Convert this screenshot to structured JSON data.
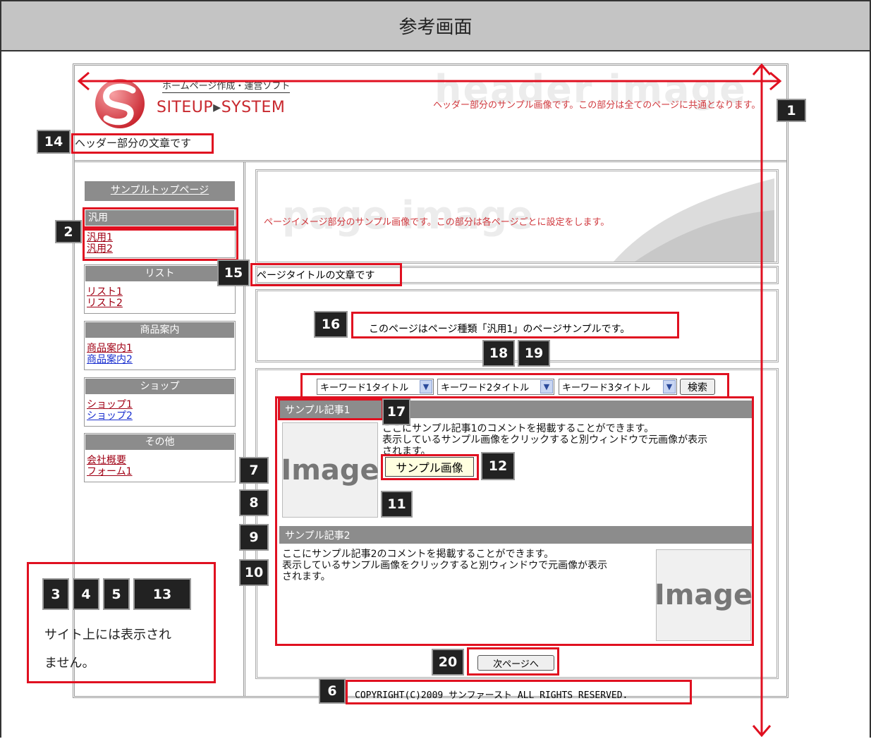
{
  "title": "参考画面",
  "header": {
    "logo_top": "ホームページ作成・運営ソフト",
    "logo_main_a": "SITEUP",
    "logo_main_b": "SYSTEM",
    "watermark": "header image",
    "sample_text": "ヘッダー部分のサンプル画像です。この部分は全てのページに共通となります。",
    "text": "ヘッダー部分の文章です"
  },
  "sidebar": {
    "top_link": "サンプルトップページ",
    "groups": [
      {
        "head": "汎用",
        "links": [
          "汎用1",
          "汎用2"
        ]
      },
      {
        "head": "リスト",
        "links": [
          "リスト1",
          "リスト2"
        ]
      },
      {
        "head": "商品案内",
        "links": [
          "商品案内1",
          "商品案内2"
        ]
      },
      {
        "head": "ショップ",
        "links": [
          "ショップ1",
          "ショップ2"
        ]
      },
      {
        "head": "その他",
        "links": [
          "会社概要",
          "フォーム1"
        ]
      }
    ]
  },
  "page_image": {
    "watermark": "page image",
    "sample_text": "ページイメージ部分のサンプル画像です。この部分は各ページごとに設定をします。"
  },
  "page_title": "ページタイトルの文章です",
  "intro": "このページはページ種類「汎用1」のページサンプルです。",
  "search": {
    "keyword1": "キーワード1タイトル",
    "keyword2": "キーワード2タイトル",
    "keyword3": "キーワード3タイトル",
    "button": "検索"
  },
  "articles": [
    {
      "title": "サンプル記事1",
      "line1": "ここにサンプル記事1のコメントを掲載することができます。",
      "line2": "表示しているサンプル画像をクリックすると別ウィンドウで元画像が表示",
      "line3": "されます。",
      "image_label": "Image",
      "caption": "サンプル画像"
    },
    {
      "title": "サンプル記事2",
      "line1": "ここにサンプル記事2のコメントを掲載することができます。",
      "line2": "表示しているサンプル画像をクリックすると別ウィンドウで元画像が表示",
      "line3": "されます。",
      "image_label": "Image"
    }
  ],
  "next_button": "次ページへ",
  "copyright": "COPYRIGHT(C)2009 サンファースト ALL RIGHTS RESERVED.",
  "note": {
    "line1": "サイト上には表示され",
    "line2": "ません。"
  },
  "badges": [
    "1",
    "2",
    "3",
    "4",
    "5",
    "6",
    "7",
    "8",
    "9",
    "10",
    "11",
    "12",
    "13",
    "14",
    "15",
    "16",
    "17",
    "18",
    "19",
    "20"
  ],
  "colors": {
    "annotation_red": "#e01020",
    "link_red": "#a00014",
    "link_blue": "#1a2fcf",
    "menu_gray": "#8c8c8c",
    "title_bar": "#c4c4c4"
  }
}
